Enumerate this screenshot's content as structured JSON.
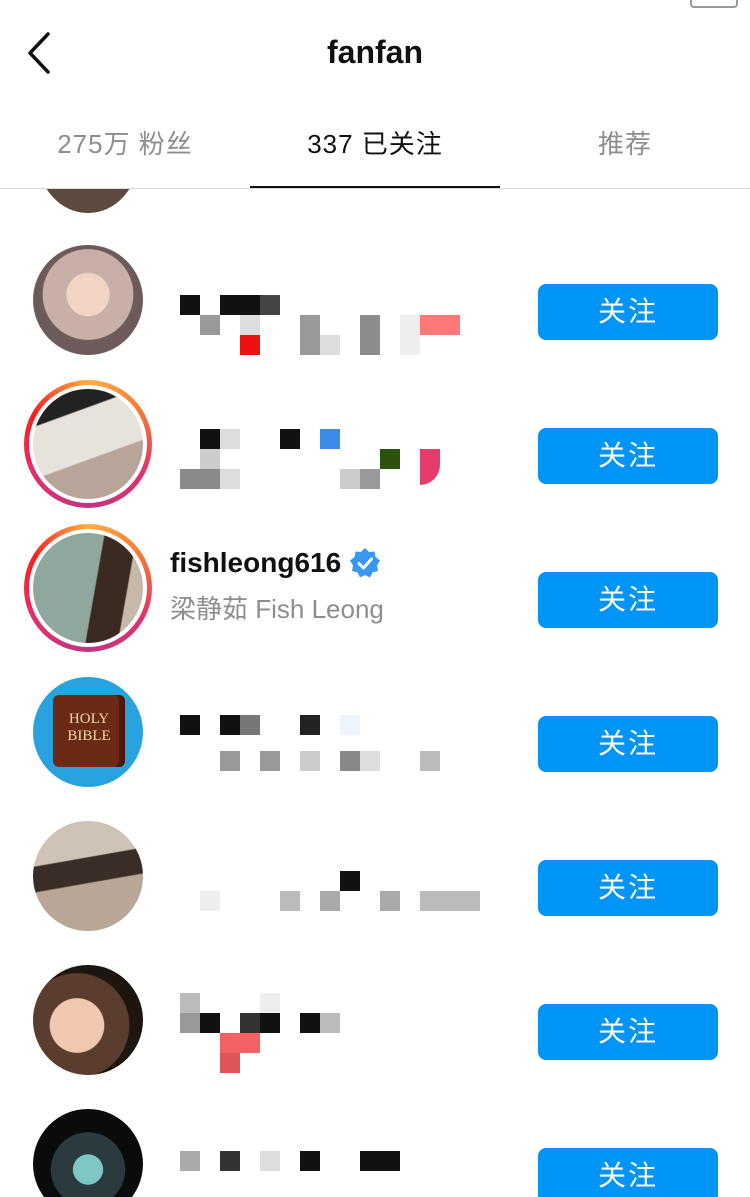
{
  "header": {
    "title": "fanfan"
  },
  "tabs": [
    {
      "label": "275万 粉丝"
    },
    {
      "label": "337 已关注"
    },
    {
      "label": "推荐"
    }
  ],
  "list": [
    {
      "username": "",
      "fullname": "",
      "button": "关注"
    },
    {
      "username": "",
      "fullname": "",
      "button": "关注"
    },
    {
      "username": "fishleong616",
      "fullname": "梁静茹 Fish Leong",
      "verified": true,
      "button": "关注"
    },
    {
      "username": "",
      "fullname": "",
      "button": "关注"
    },
    {
      "username": "",
      "fullname": "",
      "button": "关注"
    },
    {
      "username": "",
      "fullname": "",
      "button": "关注"
    },
    {
      "username": "",
      "fullname": "",
      "button": "关注"
    }
  ],
  "bible_avatar": {
    "line1": "HOLY",
    "line2": "BIBLE"
  },
  "colors": {
    "accent": "#0095f6",
    "verified": "#3897f0"
  }
}
